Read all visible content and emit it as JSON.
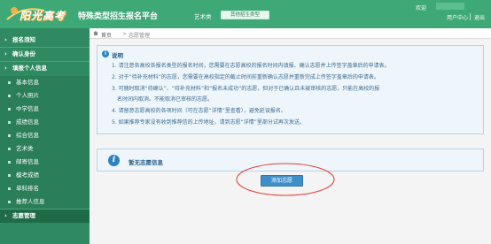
{
  "header": {
    "logo_text": "阳光高考",
    "platform_title": "特殊类型招生报名平台",
    "category_label": "艺术类",
    "switch_button": "其他招生类型",
    "welcome": "欢迎",
    "user_center": "用户中心",
    "logout": "退出",
    "colors": {
      "bar": "#3ea877",
      "logo_shadow": "#e8a33a"
    }
  },
  "sidebar": {
    "groups": [
      {
        "label": "报名须知"
      },
      {
        "label": "确认身份"
      },
      {
        "label": "填报个人信息"
      }
    ],
    "items": [
      {
        "label": "基本信息"
      },
      {
        "label": "个人照片"
      },
      {
        "label": "中学信息"
      },
      {
        "label": "成绩信息"
      },
      {
        "label": "综合信息"
      },
      {
        "label": "艺术类"
      },
      {
        "label": "邮寄信息"
      },
      {
        "label": "模考成绩"
      },
      {
        "label": "单科排名"
      },
      {
        "label": "推荐人信息"
      }
    ],
    "active": {
      "label": "志愿管理"
    }
  },
  "breadcrumb": {
    "home": "首页",
    "current": "志愿管理"
  },
  "notice": {
    "icon": "info-icon",
    "title": "说明",
    "lines": [
      "1. 请注意各高校各报名类型的报名时间，您需要在志愿高校的报名时间内填报、确认志愿并上传签字盖章后的申请表。",
      "2. 对于“待补充材料”的志愿，您需要在高校指定的截止时间前重新确认志愿并重新完成上传签字盖章后的申请表。",
      "3. 可随时取消“待确认”、“待补充材料”和“报名未成功”的志愿，但对于已确认且未被审核的志愿，只能在高校的报",
      "名时间内取消。不能取消已审核的志愿。",
      "4. 请留意志愿高校的各项时间（可在志愿“详情”里查看），避免延误报名。",
      "5. 如果推荐专家没有收到推荐信的上传地址，请到志愿“详情”里部分试再次发送。"
    ]
  },
  "empty_state": {
    "icon": "info-icon",
    "text": "暂无志愿信息"
  },
  "add_button": {
    "label": "添加志愿"
  },
  "annotation": {
    "color": "#e0403a"
  }
}
